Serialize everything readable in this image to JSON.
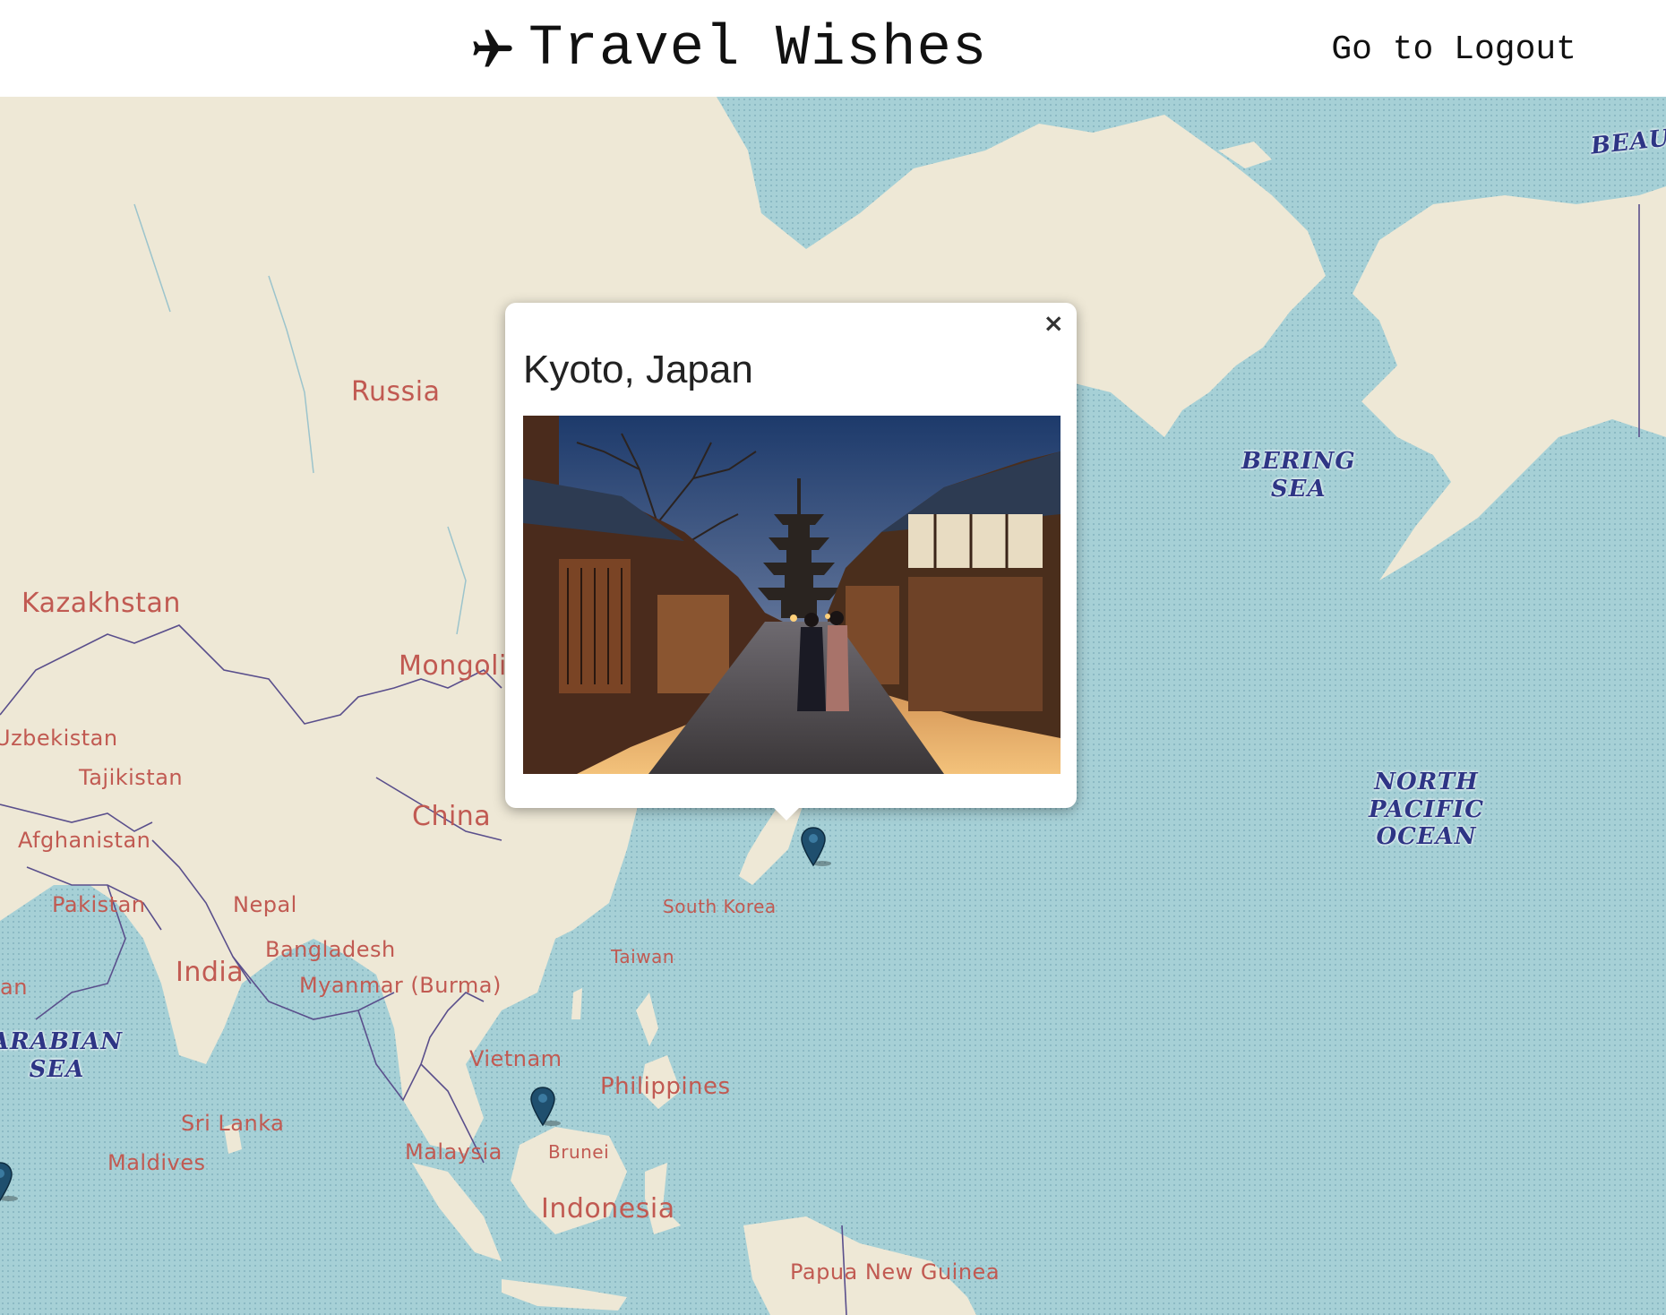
{
  "header": {
    "title": "Travel Wishes",
    "logo_icon": "airplane-icon",
    "logout_label": "Go to Logout"
  },
  "map": {
    "country_labels": [
      "Russia",
      "Kazakhstan",
      "Mongoli",
      "Uzbekistan",
      "Tajikistan",
      "Afghanistan",
      "Pakistan",
      "Nepal",
      "India",
      "Bangladesh",
      "Myanmar (Burma)",
      "China",
      "Taiwan",
      "South Korea",
      "Vietnam",
      "Philippines",
      "Sri Lanka",
      "Maldives",
      "Malaysia",
      "Brunei",
      "Indonesia",
      "Papua New Guinea",
      "an"
    ],
    "sea_labels": {
      "bering_sea": "BERING\nSEA",
      "north_pacific": "NORTH\nPACIFIC\nOCEAN",
      "arabian_sea": "ARABIAN\nSEA",
      "beaufort": "BEAU"
    },
    "colors": {
      "land": "#eee8d6",
      "water": "#a6d0d6",
      "border": "#5a4f8c",
      "label": "#c15a52",
      "sea_label": "#2e3585",
      "marker": "#1f4f6e"
    }
  },
  "popup": {
    "title": "Kyoto, Japan",
    "close_label": "×",
    "photo_icon": "kyoto-street-pagoda-photo"
  }
}
